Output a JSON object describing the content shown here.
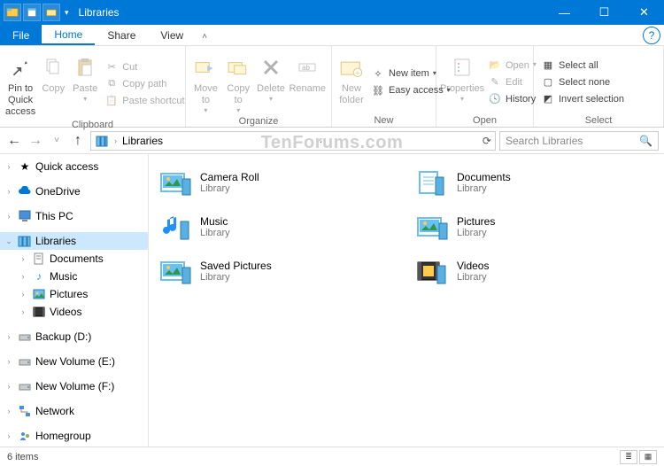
{
  "window": {
    "title": "Libraries"
  },
  "tabs": {
    "file": "File",
    "home": "Home",
    "share": "Share",
    "view": "View"
  },
  "ribbon": {
    "clipboard": {
      "label": "Clipboard",
      "pin": "Pin to Quick access",
      "copy": "Copy",
      "paste": "Paste",
      "cut": "Cut",
      "copy_path": "Copy path",
      "paste_shortcut": "Paste shortcut"
    },
    "organize": {
      "label": "Organize",
      "move_to": "Move to",
      "copy_to": "Copy to",
      "delete": "Delete",
      "rename": "Rename"
    },
    "new": {
      "label": "New",
      "new_folder": "New folder",
      "new_item": "New item",
      "easy_access": "Easy access"
    },
    "open": {
      "label": "Open",
      "properties": "Properties",
      "open": "Open",
      "edit": "Edit",
      "history": "History"
    },
    "select": {
      "label": "Select",
      "select_all": "Select all",
      "select_none": "Select none",
      "invert": "Invert selection"
    }
  },
  "address": {
    "path": "Libraries"
  },
  "search": {
    "placeholder": "Search Libraries"
  },
  "nav": {
    "quick_access": "Quick access",
    "onedrive": "OneDrive",
    "this_pc": "This PC",
    "libraries": "Libraries",
    "documents": "Documents",
    "music": "Music",
    "pictures": "Pictures",
    "videos": "Videos",
    "backup": "Backup (D:)",
    "newvol_e": "New Volume (E:)",
    "newvol_f": "New Volume (F:)",
    "network": "Network",
    "homegroup": "Homegroup"
  },
  "content": {
    "type_label": "Library",
    "items": [
      {
        "name": "Camera Roll"
      },
      {
        "name": "Documents"
      },
      {
        "name": "Music"
      },
      {
        "name": "Pictures"
      },
      {
        "name": "Saved Pictures"
      },
      {
        "name": "Videos"
      }
    ]
  },
  "status": {
    "count": "6 items"
  },
  "watermark": "TenForums.com"
}
